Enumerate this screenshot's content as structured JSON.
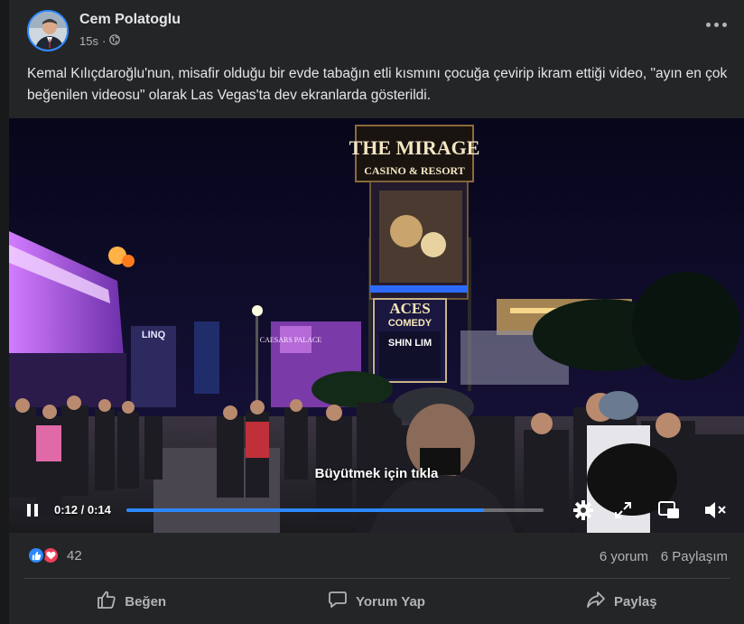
{
  "post": {
    "author": "Cem Polatoglu",
    "timestamp": "15s",
    "separator": "·",
    "privacy_icon": "globe-icon",
    "more_icon": "more-icon",
    "caption": "Kemal Kılıçdaroğlu'nun, misafir olduğu bir evde tabağın etli kısmını çocuğa çevirip ikram ettiği video, \"ayın en çok beğenilen videosu\" olarak Las Vegas'ta dev ekranlarda gösterildi."
  },
  "video": {
    "overlay_text": "Büyütmek için tıkla",
    "time": "0:12 / 0:14",
    "progress": 0.857,
    "signs": {
      "mirage_top": "THE MIRAGE",
      "mirage_sub": "CASINO & RESORT",
      "aces": "ACES",
      "comedy": "COMEDY",
      "shin": "SHIN LIM",
      "linq": "LINQ",
      "palace": "CAESARS PALACE"
    },
    "icons": [
      "pause-icon",
      "settings-icon",
      "fullscreen-icon",
      "pip-icon",
      "mute-icon"
    ]
  },
  "stats": {
    "reaction_count": "42",
    "comments": "6 yorum",
    "shares": "6 Paylaşım"
  },
  "actions": {
    "like": "Beğen",
    "comment": "Yorum Yap",
    "share": "Paylaş"
  },
  "colors": {
    "background": "#242526",
    "accent": "#2d88ff",
    "love": "#f33e58",
    "secondary_text": "#b0b3b8"
  }
}
